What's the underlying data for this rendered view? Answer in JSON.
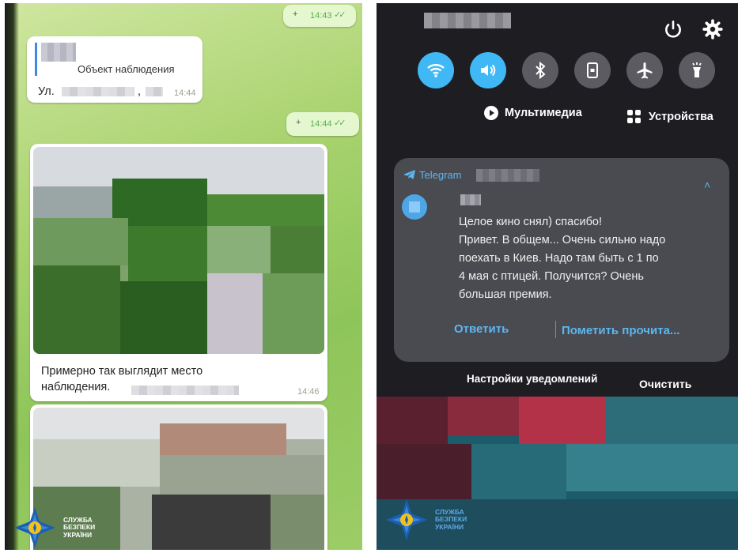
{
  "left_chat": {
    "top_time": "14:43",
    "reply_title": "Объект наблюдения",
    "reply_address_prefix": "Ул.",
    "reply_address_suffix": ",",
    "reply_time": "14:44",
    "out_time_2": "14:44",
    "photo_caption": "Примерно так выглядит место наблюдения.",
    "photo_time": "14:46"
  },
  "notification_panel": {
    "date_text": "...",
    "media_button": "Мультимедиа",
    "devices_button": "Устройства",
    "notification": {
      "app": "Telegram",
      "text": "Целое кино снял) спасибо!\nПривет. В общем... Очень сильно надо\nпоехать в Киев. Надо там быть с 1 по\n4 мая с птицей. Получится? Очень\nбольшая премия.",
      "reply_action": "Ответить",
      "mark_read_action": "Пометить прочита..."
    },
    "notification_settings": "Настройки уведомлений",
    "clear_all": "Очистить"
  },
  "logo": {
    "line1": "СЛУЖБА",
    "line2": "БЕЗПЕКИ",
    "line3": "УКРАЇНИ"
  },
  "colors": {
    "telegram_accent": "#5ab8f0",
    "quick_toggle_on": "#3fb8f5",
    "quick_toggle_off": "#5c5b61",
    "logo_left": "#ffffff",
    "logo_right": "#5ea8e6"
  },
  "icons": [
    "wifi-icon",
    "sound-icon",
    "bluetooth-icon",
    "portrait-lock-icon",
    "airplane-icon",
    "flashlight-icon",
    "power-icon",
    "gear-icon",
    "play-icon",
    "devices-icon",
    "telegram-icon",
    "chevron-up-icon",
    "check-icon"
  ]
}
